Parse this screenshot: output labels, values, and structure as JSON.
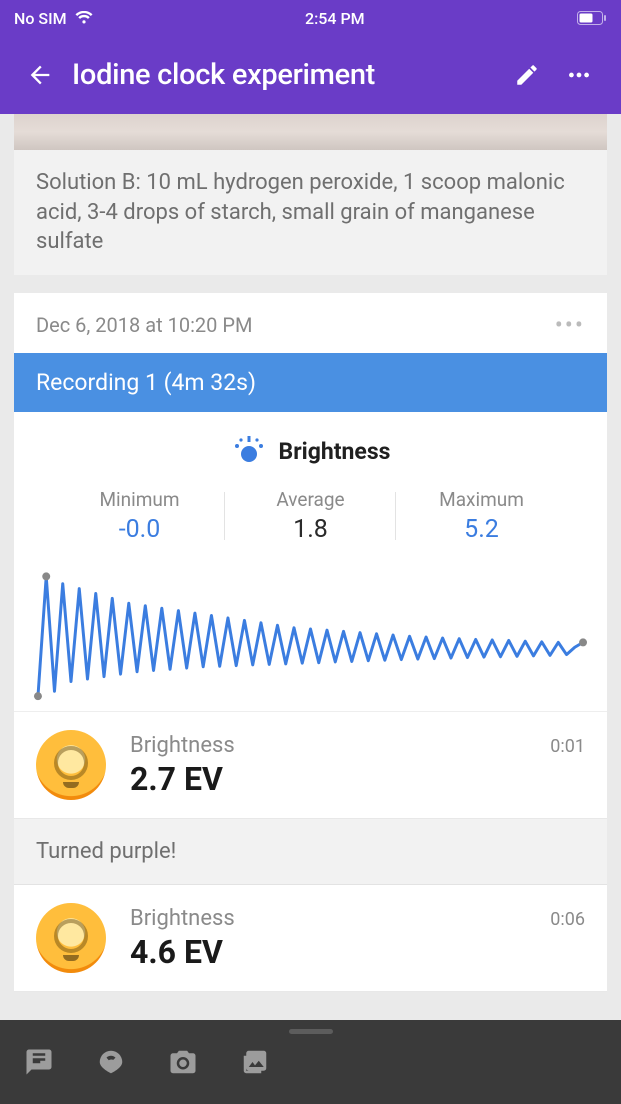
{
  "status": {
    "carrier": "No SIM",
    "time": "2:54 PM"
  },
  "header": {
    "title": "Iodine clock experiment"
  },
  "note_card": {
    "text": "Solution B: 10 mL hydrogen peroxide, 1 scoop malonic acid, 3-4 drops of starch, small grain of manganese sulfate"
  },
  "recording": {
    "date": "Dec 6, 2018 at 10:20 PM",
    "banner": "Recording 1 (4m 32s)",
    "sensor": "Brightness",
    "stats": {
      "min_label": "Minimum",
      "min_value": "-0.0",
      "avg_label": "Average",
      "avg_value": "1.8",
      "max_label": "Maximum",
      "max_value": "5.2"
    }
  },
  "chart_data": {
    "type": "line",
    "title": "Brightness",
    "ylim": [
      -0.0,
      5.2
    ],
    "x_range_seconds": [
      0,
      272
    ],
    "values": [
      0.2,
      5.1,
      0.4,
      4.8,
      0.8,
      4.6,
      0.9,
      4.4,
      1.0,
      4.2,
      1.1,
      4.0,
      1.2,
      3.9,
      1.25,
      3.8,
      1.3,
      3.7,
      1.35,
      3.6,
      1.4,
      3.5,
      1.42,
      3.4,
      1.45,
      3.3,
      1.48,
      3.2,
      1.5,
      3.1,
      1.52,
      3.0,
      1.55,
      2.95,
      1.57,
      2.9,
      1.6,
      2.85,
      1.62,
      2.8,
      1.65,
      2.75,
      1.67,
      2.7,
      1.7,
      2.65,
      1.72,
      2.62,
      1.74,
      2.58,
      1.76,
      2.55,
      1.78,
      2.52,
      1.8,
      2.5,
      1.81,
      2.48,
      1.83,
      2.45,
      1.85,
      2.42,
      1.87,
      2.4,
      1.9,
      2.2,
      2.4
    ]
  },
  "observations": [
    {
      "label": "Brightness",
      "value": "2.7 EV",
      "time": "0:01"
    },
    {
      "label": "Brightness",
      "value": "4.6 EV",
      "time": "0:06"
    }
  ],
  "annotation": {
    "text": "Turned purple!"
  }
}
